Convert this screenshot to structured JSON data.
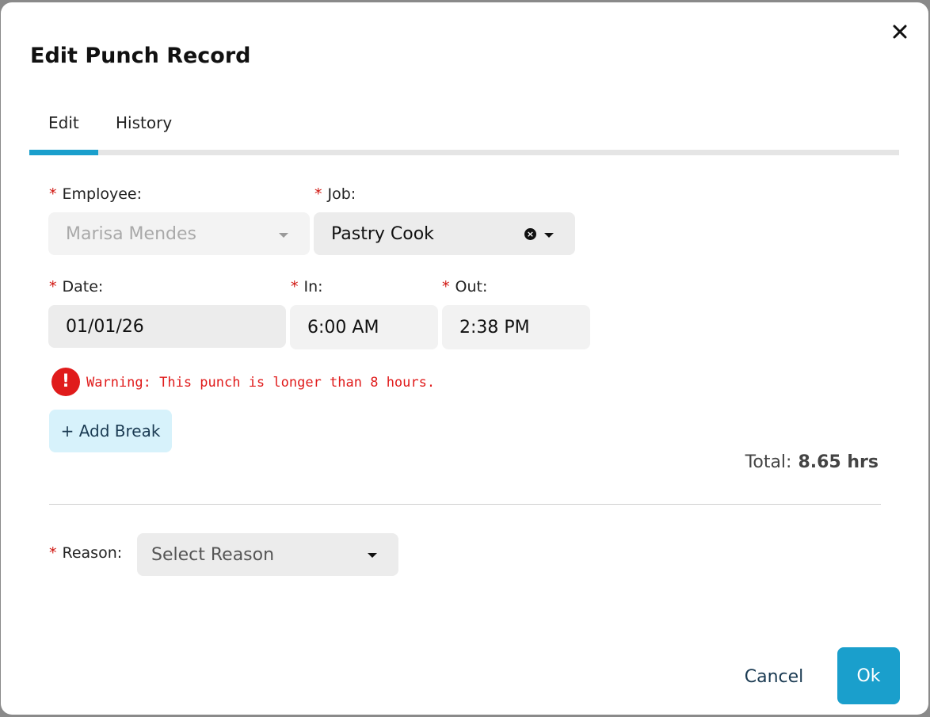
{
  "dialog": {
    "title": "Edit Punch Record",
    "close_icon": "close-icon"
  },
  "tabs": [
    {
      "label": "Edit",
      "active": true
    },
    {
      "label": "History",
      "active": false
    }
  ],
  "accent_color": "#1a9fcc",
  "required_marker": "*",
  "form": {
    "employee": {
      "label": "Employee",
      "value": "Marisa Mendes",
      "disabled": true
    },
    "job": {
      "label": "Job",
      "value": "Pastry Cook"
    },
    "date": {
      "label": "Date",
      "value": "01/01/26"
    },
    "time_in": {
      "label": "In",
      "value": "6:00 AM"
    },
    "time_out": {
      "label": "Out",
      "value": "2:38 PM"
    },
    "reason": {
      "label": "Reason",
      "placeholder": "Select Reason"
    }
  },
  "warning": {
    "icon": "!",
    "text": "Warning: This punch is longer than 8 hours.",
    "color": "#e01b1b"
  },
  "add_break_label": "+ Add Break",
  "total": {
    "label": "Total:",
    "value": "8.65 hrs"
  },
  "footer": {
    "cancel_label": "Cancel",
    "ok_label": "Ok"
  }
}
